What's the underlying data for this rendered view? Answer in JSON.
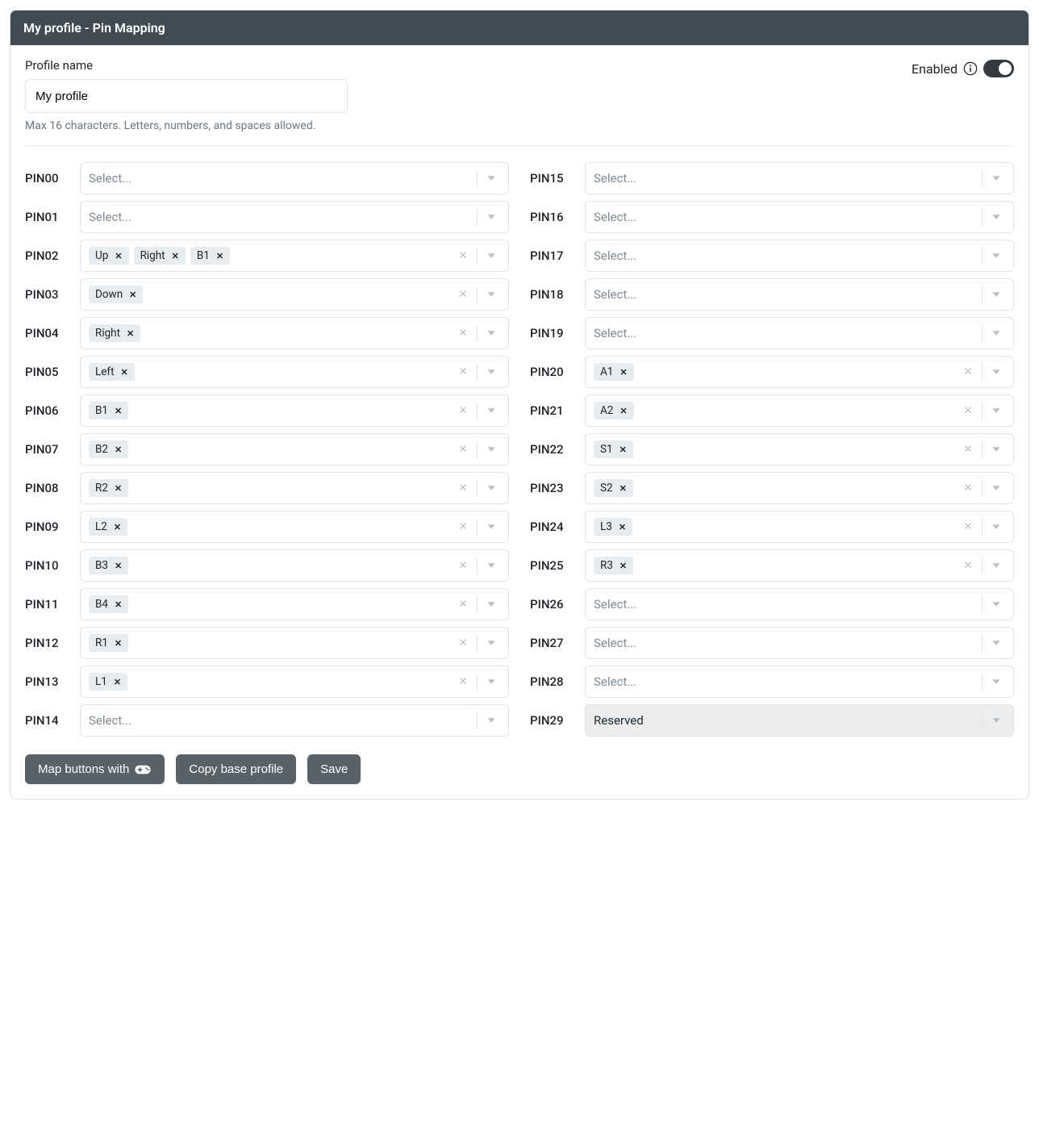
{
  "panel": {
    "title": "My profile - Pin Mapping"
  },
  "profileName": {
    "label": "Profile name",
    "value": "My profile",
    "hint": "Max 16 characters. Letters, numbers, and spaces allowed."
  },
  "enabled": {
    "label": "Enabled",
    "value": true
  },
  "selectPlaceholder": "Select...",
  "reservedLabel": "Reserved",
  "pinsLeft": [
    {
      "label": "PIN00",
      "tags": []
    },
    {
      "label": "PIN01",
      "tags": []
    },
    {
      "label": "PIN02",
      "tags": [
        "Up",
        "Right",
        "B1"
      ]
    },
    {
      "label": "PIN03",
      "tags": [
        "Down"
      ]
    },
    {
      "label": "PIN04",
      "tags": [
        "Right"
      ]
    },
    {
      "label": "PIN05",
      "tags": [
        "Left"
      ]
    },
    {
      "label": "PIN06",
      "tags": [
        "B1"
      ]
    },
    {
      "label": "PIN07",
      "tags": [
        "B2"
      ]
    },
    {
      "label": "PIN08",
      "tags": [
        "R2"
      ]
    },
    {
      "label": "PIN09",
      "tags": [
        "L2"
      ]
    },
    {
      "label": "PIN10",
      "tags": [
        "B3"
      ]
    },
    {
      "label": "PIN11",
      "tags": [
        "B4"
      ]
    },
    {
      "label": "PIN12",
      "tags": [
        "R1"
      ]
    },
    {
      "label": "PIN13",
      "tags": [
        "L1"
      ]
    },
    {
      "label": "PIN14",
      "tags": []
    }
  ],
  "pinsRight": [
    {
      "label": "PIN15",
      "tags": []
    },
    {
      "label": "PIN16",
      "tags": []
    },
    {
      "label": "PIN17",
      "tags": []
    },
    {
      "label": "PIN18",
      "tags": []
    },
    {
      "label": "PIN19",
      "tags": []
    },
    {
      "label": "PIN20",
      "tags": [
        "A1"
      ]
    },
    {
      "label": "PIN21",
      "tags": [
        "A2"
      ]
    },
    {
      "label": "PIN22",
      "tags": [
        "S1"
      ]
    },
    {
      "label": "PIN23",
      "tags": [
        "S2"
      ]
    },
    {
      "label": "PIN24",
      "tags": [
        "L3"
      ]
    },
    {
      "label": "PIN25",
      "tags": [
        "R3"
      ]
    },
    {
      "label": "PIN26",
      "tags": []
    },
    {
      "label": "PIN27",
      "tags": []
    },
    {
      "label": "PIN28",
      "tags": []
    },
    {
      "label": "PIN29",
      "reserved": true
    }
  ],
  "buttons": {
    "map": "Map buttons with",
    "copy": "Copy base profile",
    "save": "Save"
  }
}
